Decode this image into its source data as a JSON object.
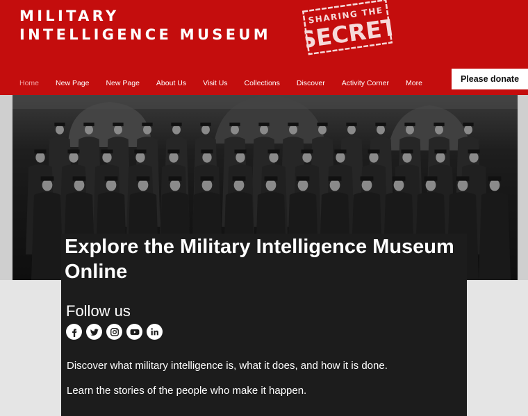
{
  "site": {
    "title_line1": "MILITARY",
    "title_line2": "INTELLIGENCE MUSEUM",
    "stamp": {
      "line1": "SHARING THE",
      "line2": "SECRET"
    }
  },
  "nav": {
    "items": [
      "Home",
      "New Page",
      "New Page",
      "About Us",
      "Visit Us",
      "Collections",
      "Discover",
      "Activity Corner",
      "More"
    ],
    "active_index": 0
  },
  "donate_label": "Please donate",
  "hero": {
    "title": "Explore the Military Intelligence Museum Online"
  },
  "follow": {
    "heading": "Follow us",
    "icons": [
      "facebook-icon",
      "twitter-icon",
      "instagram-icon",
      "youtube-icon",
      "linkedin-icon"
    ]
  },
  "intro": {
    "p1": "Discover what military intelligence is, what it does, and how it is done.",
    "p2": "Learn the stories of the people who make it happen."
  },
  "colors": {
    "brand_red": "#c40d0d",
    "panel": "#1c1c1c",
    "nav_active": "#f3a9a9"
  }
}
